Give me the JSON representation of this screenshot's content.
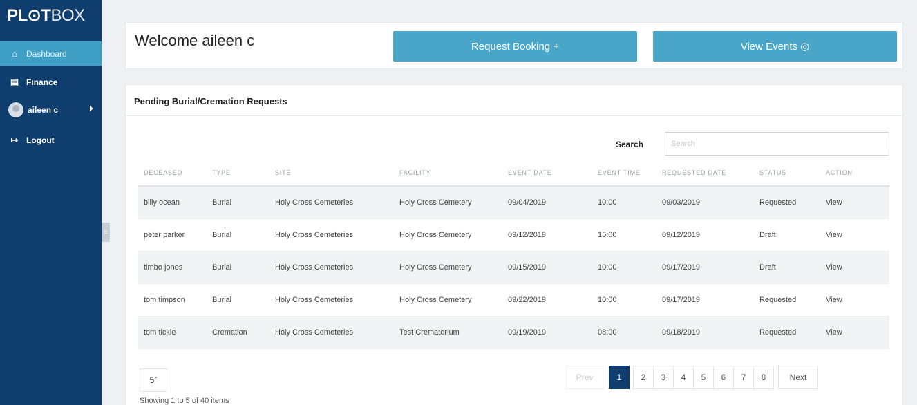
{
  "sidebar": {
    "logo_bold": "PL⊙T",
    "logo_light": "BOX",
    "items": [
      {
        "label": "Dashboard",
        "icon": "home-icon"
      },
      {
        "label": "Finance",
        "icon": "finance-icon"
      },
      {
        "label": "aileen c",
        "icon": "avatar"
      },
      {
        "label": "Logout",
        "icon": "logout-icon"
      }
    ]
  },
  "welcome": {
    "title": "Welcome aileen c",
    "request_booking": "Request Booking +",
    "view_events": "View Events ◎"
  },
  "pending": {
    "header": "Pending Burial/Cremation Requests",
    "search_label": "Search",
    "search_placeholder": "Search",
    "search_value": "",
    "columns": [
      "DECEASED",
      "TYPE",
      "SITE",
      "FACILITY",
      "EVENT DATE",
      "EVENT TIME",
      "REQUESTED DATE",
      "STATUS",
      "ACTION"
    ],
    "rows": [
      [
        "billy ocean",
        "Burial",
        "Holy Cross Cemeteries",
        "Holy Cross Cemetery",
        "09/04/2019",
        "10:00",
        "09/03/2019",
        "Requested",
        "View"
      ],
      [
        "peter parker",
        "Burial",
        "Holy Cross Cemeteries",
        "Holy Cross Cemetery",
        "09/12/2019",
        "15:00",
        "09/12/2019",
        "Draft",
        "View"
      ],
      [
        "timbo jones",
        "Burial",
        "Holy Cross Cemeteries",
        "Holy Cross Cemetery",
        "09/15/2019",
        "10:00",
        "09/17/2019",
        "Draft",
        "View"
      ],
      [
        "tom timpson",
        "Burial",
        "Holy Cross Cemeteries",
        "Holy Cross Cemetery",
        "09/22/2019",
        "10:00",
        "09/17/2019",
        "Requested",
        "View"
      ],
      [
        "tom tickle",
        "Cremation",
        "Holy Cross Cemeteries",
        "Test Crematorium",
        "09/19/2019",
        "08:00",
        "09/18/2019",
        "Requested",
        "View"
      ]
    ],
    "page_size": "5",
    "pagination": {
      "prev": "Prev",
      "pages": [
        "1",
        "2",
        "3",
        "4",
        "5",
        "6",
        "7",
        "8"
      ],
      "active": "1",
      "next": "Next"
    },
    "showing": "Showing 1 to 5 of 40 items"
  },
  "colors": {
    "sidebar": "#0f3d6e",
    "accent": "#4aa6c8",
    "active_nav": "#3f9ec4"
  }
}
